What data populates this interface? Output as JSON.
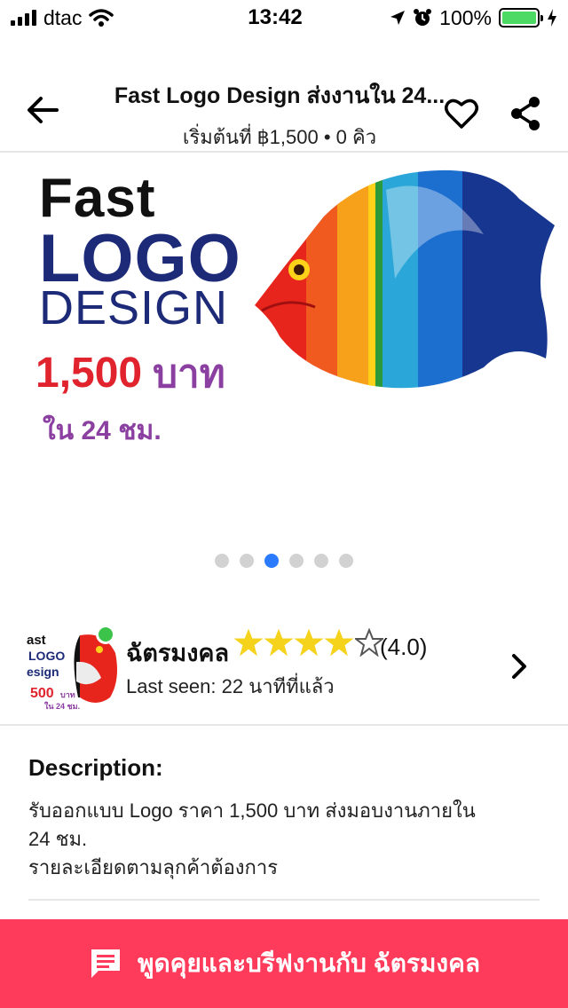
{
  "status_bar": {
    "carrier": "dtac",
    "time": "13:42",
    "battery": "100%",
    "battery_level": 1.0,
    "battery_color": "#4cd964"
  },
  "nav": {
    "title": "Fast Logo Design ส่งงานใน 24...",
    "subtitle": "เริ่มต้นที่ ฿1,500 • 0 คิว",
    "back_icon": "arrow-left-icon",
    "favorite_icon": "heart-outline-icon",
    "share_icon": "share-icon"
  },
  "banner": {
    "line1": "Fast",
    "line2": "LOGO",
    "line3": "DESIGN",
    "price": "1,500",
    "price_unit": "บาท",
    "delivery": "ใน 24 ชม.",
    "slides_count": 6,
    "active_slide": 3,
    "colors": {
      "navy": "#1c2a78",
      "red": "#e0232d",
      "purple": "#8b3fa0",
      "active_dot": "#2b7bff"
    }
  },
  "seller": {
    "name": "ฉัตรมงคล",
    "rating_value": 4,
    "rating_max": 5,
    "rating_text": "(4.0)",
    "last_seen": "Last seen: 22 นาทีที่แล้ว",
    "online_color": "#3bc34a",
    "avatar_lines": [
      "ast",
      "LOGO",
      "esign",
      "500",
      "บาท",
      "ใน 24 ชม."
    ]
  },
  "description": {
    "title": "Description:",
    "text": "รับออกแบบ Logo ราคา 1,500 บาท ส่งมอบงานภายใน\n24 ชม.\nรายละเอียดตามลุกค้าต้องการ"
  },
  "chat_button": {
    "label": "พูดคุยและบรีฟงานกับ ฉัตรมงคล",
    "icon": "chat-bubble-icon",
    "color": "#ff3b5c"
  }
}
